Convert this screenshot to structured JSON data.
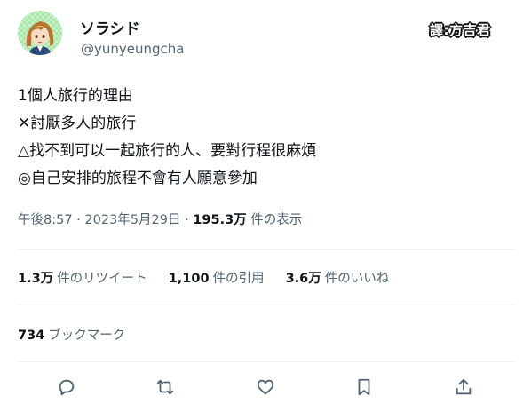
{
  "author": {
    "display_name": "ソラシド",
    "handle": "@yunyeungcha",
    "avatar_icon": "anime-girl-avatar-icon"
  },
  "translator_credit": "譯:方吉君",
  "tweet": {
    "lines": [
      "1個人旅行的理由",
      "✕討厭多人的旅行",
      "△找不到可以一起旅行的人、要對行程很麻煩",
      "◎自己安排的旅程不會有人願意參加"
    ]
  },
  "meta": {
    "time": "午後8:57",
    "sep1": "·",
    "date": "2023年5月29日",
    "sep2": "·",
    "views_count": "195.3万",
    "views_label": "件の表示"
  },
  "stats": {
    "retweets_count": "1.3万",
    "retweets_label": "件のリツイート",
    "quotes_count": "1,100",
    "quotes_label": "件の引用",
    "likes_count": "3.6万",
    "likes_label": "件のいいね"
  },
  "bookmarks": {
    "count": "734",
    "label": "ブックマーク"
  },
  "actions": [
    {
      "icon": "reply-icon"
    },
    {
      "icon": "retweet-icon"
    },
    {
      "icon": "like-heart-icon"
    },
    {
      "icon": "bookmark-icon"
    },
    {
      "icon": "share-icon"
    }
  ],
  "colors": {
    "text": "#0f1419",
    "muted": "#536471",
    "divider": "#eff3f4"
  }
}
